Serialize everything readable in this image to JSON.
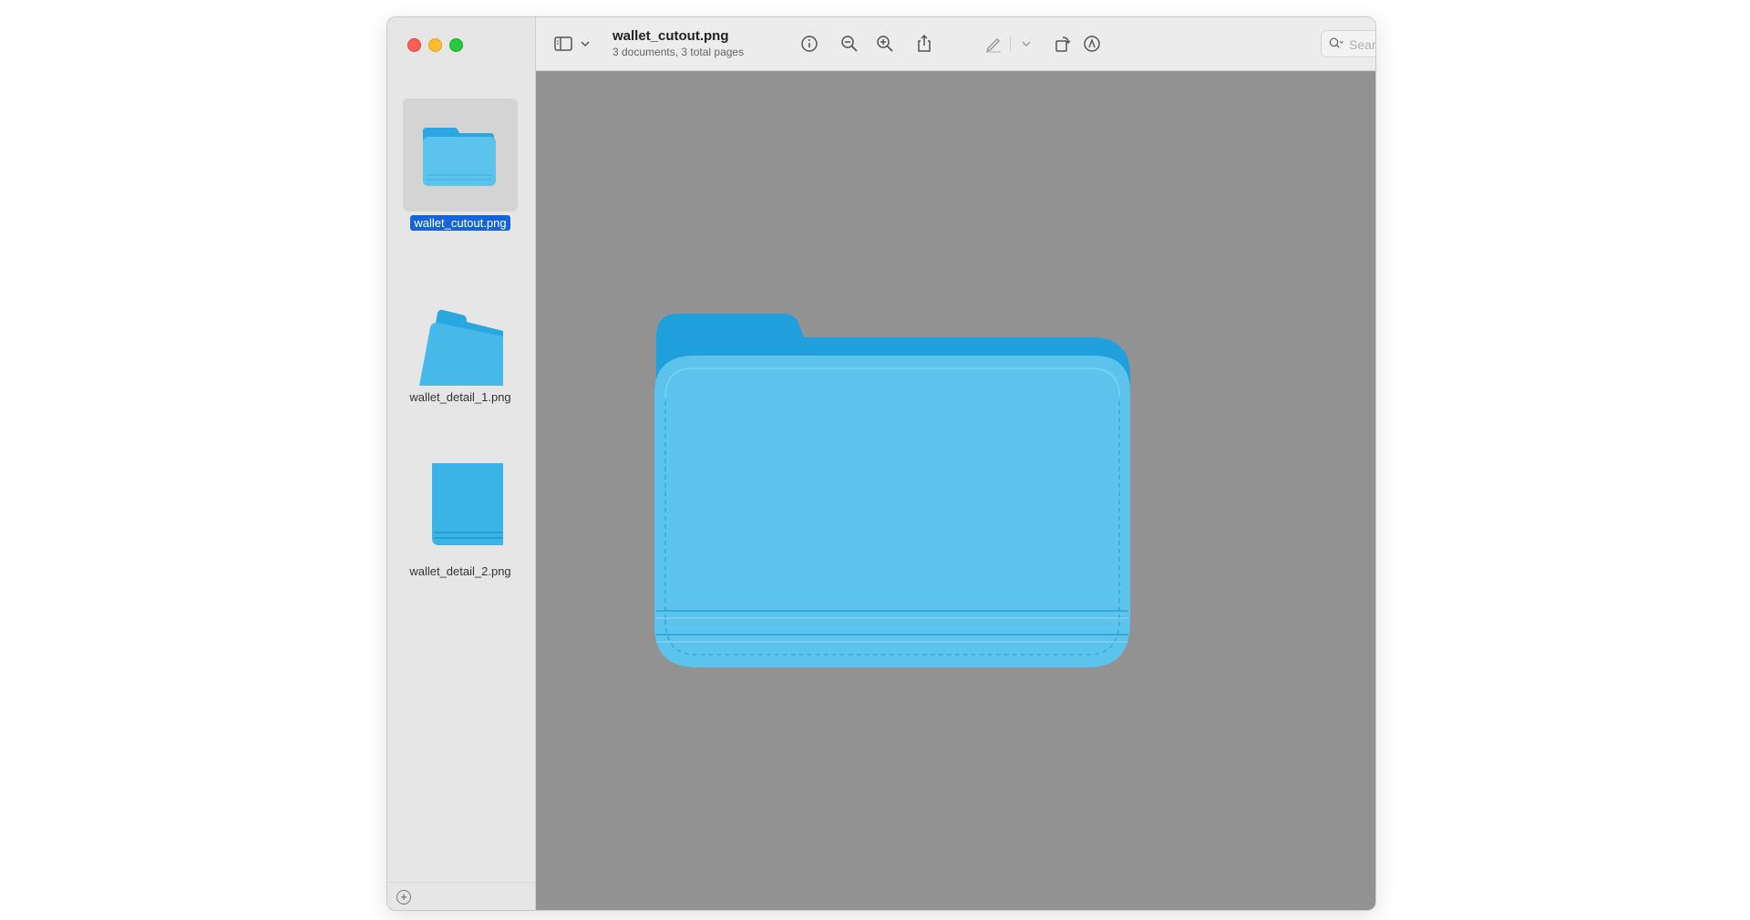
{
  "window": {
    "title": "wallet_cutout.png",
    "subtitle": "3 documents, 3 total pages"
  },
  "toolbar": {
    "icons": [
      "sidebar-icon",
      "chevron-down-icon",
      "info-icon",
      "zoom-out-icon",
      "zoom-in-icon",
      "share-icon",
      "highlight-pen-icon",
      "chevron-down-icon",
      "rotate-icon",
      "markup-icon",
      "search-icon"
    ]
  },
  "search": {
    "placeholder": "Search",
    "value": ""
  },
  "sidebar": {
    "items": [
      {
        "label": "wallet_cutout.png",
        "selected": true
      },
      {
        "label": "wallet_detail_1.png",
        "selected": false
      },
      {
        "label": "wallet_detail_2.png",
        "selected": false
      }
    ]
  },
  "colors": {
    "accent": "#1764d9",
    "canvas": "#929292",
    "wallet": "#5cc4ec",
    "wallet_dark": "#2aa6e0"
  }
}
